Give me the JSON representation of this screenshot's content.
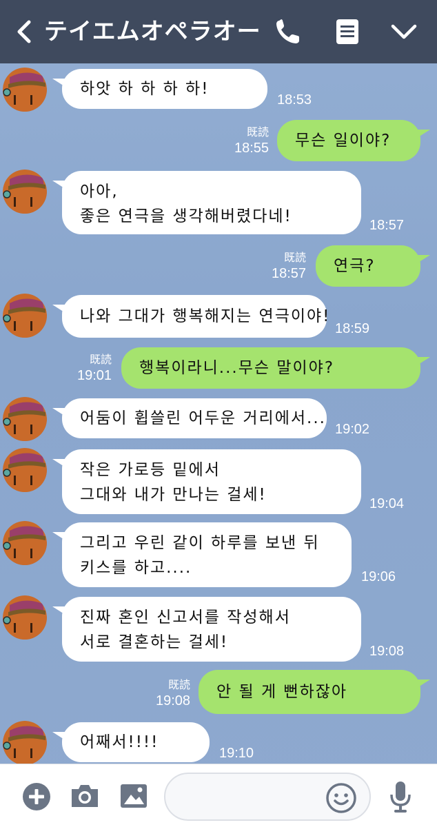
{
  "header": {
    "title": "テイエムオペラオー",
    "icons": [
      "back-icon",
      "phone-icon",
      "menu-icon",
      "chevron-down-icon"
    ]
  },
  "messages": [
    {
      "from": "them",
      "lines": [
        "하앗 하 하 하 하!"
      ],
      "time": "18:53"
    },
    {
      "from": "me",
      "lines": [
        "무슨 일이야?"
      ],
      "read": "既読",
      "time": "18:55"
    },
    {
      "from": "them",
      "lines": [
        "아아,",
        "좋은 연극을 생각해버렸다네!"
      ],
      "time": "18:57"
    },
    {
      "from": "me",
      "lines": [
        "연극?"
      ],
      "read": "既読",
      "time": "18:57"
    },
    {
      "from": "them",
      "lines": [
        "나와 그대가 행복해지는 연극이야!"
      ],
      "time": "18:59"
    },
    {
      "from": "me",
      "lines": [
        "행복이라니...무슨 말이야?"
      ],
      "read": "既読",
      "time": "19:01"
    },
    {
      "from": "them",
      "lines": [
        "어둠이 휩쓸린 어두운 거리에서..."
      ],
      "time": "19:02"
    },
    {
      "from": "them",
      "lines": [
        "작은 가로등 밑에서",
        "그대와 내가 만나는 걸세!"
      ],
      "time": "19:04"
    },
    {
      "from": "them",
      "lines": [
        "그리고 우린 같이 하루를 보낸 뒤",
        "키스를 하고...."
      ],
      "time": "19:06"
    },
    {
      "from": "them",
      "lines": [
        "진짜 혼인 신고서를 작성해서",
        "서로 결혼하는 걸세!"
      ],
      "time": "19:08"
    },
    {
      "from": "me",
      "lines": [
        "안 될 게 뻔하잖아"
      ],
      "read": "既読",
      "time": "19:08"
    },
    {
      "from": "them",
      "lines": [
        "어째서!!!!"
      ],
      "time": "19:10"
    }
  ],
  "composer": {
    "placeholder": "",
    "icons": [
      "plus-icon",
      "camera-icon",
      "image-icon",
      "emoji-icon",
      "microphone-icon"
    ]
  },
  "colors": {
    "header_bg": "#3f4a5e",
    "chat_bg": "#8ea9cf",
    "my_bubble": "#a5e36e",
    "their_bubble": "#ffffff",
    "icon_gray": "#6b7585"
  }
}
